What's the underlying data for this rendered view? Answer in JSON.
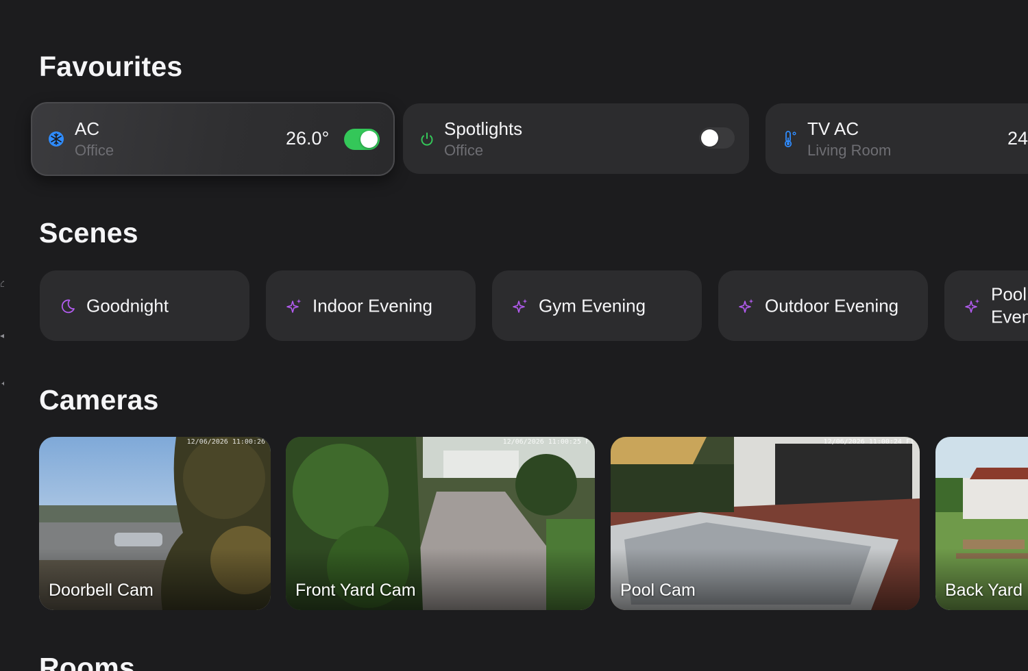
{
  "sections": {
    "favourites": "Favourites",
    "scenes": "Scenes",
    "cameras": "Cameras",
    "rooms": "Rooms"
  },
  "favourites": [
    {
      "name": "AC",
      "room": "Office",
      "value": "26.0°",
      "toggle": "on",
      "icon": "snowflake-icon"
    },
    {
      "name": "Spotlights",
      "room": "Office",
      "toggle": "off",
      "icon": "power-icon"
    },
    {
      "name": "TV AC",
      "room": "Living Room",
      "value": "24",
      "icon": "thermometer-icon"
    }
  ],
  "scenes": [
    {
      "label": "Goodnight",
      "icon": "moon-icon"
    },
    {
      "label": "Indoor Evening",
      "icon": "sparkles-icon"
    },
    {
      "label": "Gym Evening",
      "icon": "sparkles-icon"
    },
    {
      "label": "Outdoor Evening",
      "icon": "sparkles-icon"
    },
    {
      "label": "Pool Even",
      "icon": "sparkles-icon"
    }
  ],
  "cameras": [
    {
      "label": "Doorbell Cam",
      "timestamp": "12/06/2026 11:00:26"
    },
    {
      "label": "Front Yard Cam",
      "timestamp": "12/06/2026 11:00:25 F"
    },
    {
      "label": "Pool Cam",
      "timestamp": "12/06/2026 11:00:24 Fi"
    },
    {
      "label": "Back Yard",
      "timestamp": ""
    }
  ],
  "colors": {
    "background": "#1c1c1e",
    "tile": "#2c2c2e",
    "toggle_on": "#34c759",
    "scene_icon": "#b35cf0",
    "ac_icon": "#2f8cff",
    "power_icon": "#34c759"
  }
}
